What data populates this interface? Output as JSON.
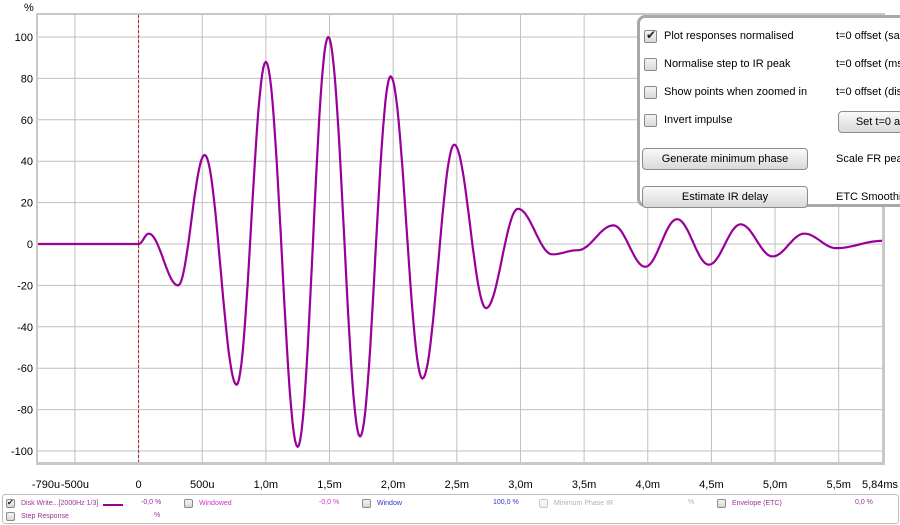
{
  "chart_data": {
    "type": "line",
    "title": "",
    "xlabel": "",
    "ylabel": "%",
    "x_unit_label": "ms",
    "xlim_ms": [
      -0.79,
      5.84
    ],
    "ylim": [
      -110,
      110
    ],
    "y_ticks": [
      100,
      80,
      60,
      40,
      20,
      0,
      -20,
      -40,
      -60,
      -80,
      -100
    ],
    "y_tick_labels": [
      "100",
      "80",
      "60",
      "40",
      "20",
      "0",
      "-20",
      "-40",
      "-60",
      "-80",
      "-100"
    ],
    "x_ticks_ms": [
      -0.79,
      -0.5,
      0,
      0.5,
      1.0,
      1.5,
      2.0,
      2.5,
      3.0,
      3.5,
      4.0,
      4.5,
      5.0,
      5.5,
      5.84
    ],
    "x_tick_labels": [
      "-790u",
      "-500u",
      "0",
      "500u",
      "1,0m",
      "1,5m",
      "2,0m",
      "2,5m",
      "3,0m",
      "3,5m",
      "4,0m",
      "4,5m",
      "5,0m",
      "5,5m",
      "5,84ms"
    ],
    "grid": true,
    "marker_line_ms": 0,
    "series": [
      {
        "name": "Disk Write...[2000Hz 1/3]",
        "color": "#990099",
        "points": [
          [
            -0.79,
            0
          ],
          [
            0,
            0
          ],
          [
            0.08,
            5
          ],
          [
            0.31,
            -20
          ],
          [
            0.52,
            43
          ],
          [
            0.77,
            -68
          ],
          [
            1.0,
            88
          ],
          [
            1.25,
            -98
          ],
          [
            1.49,
            100
          ],
          [
            1.74,
            -93
          ],
          [
            1.98,
            81
          ],
          [
            2.23,
            -65
          ],
          [
            2.48,
            48
          ],
          [
            2.73,
            -31
          ],
          [
            2.98,
            17
          ],
          [
            3.25,
            -5
          ],
          [
            3.45,
            -3
          ],
          [
            3.73,
            9
          ],
          [
            3.98,
            -11
          ],
          [
            4.23,
            12
          ],
          [
            4.48,
            -10
          ],
          [
            4.73,
            9.5
          ],
          [
            4.98,
            -6
          ],
          [
            5.23,
            5
          ],
          [
            5.48,
            -2
          ],
          [
            5.84,
            1.5
          ]
        ]
      }
    ]
  },
  "panel": {
    "checkboxes": [
      {
        "label": "Plot responses normalised",
        "checked": true
      },
      {
        "label": "Normalise step to IR peak",
        "checked": false
      },
      {
        "label": "Show points when zoomed in",
        "checked": false
      },
      {
        "label": "Invert impulse",
        "checked": false
      }
    ],
    "right_labels": [
      "t=0 offset (sa",
      "t=0 offset (ms",
      "t=0 offset (dis"
    ],
    "set_t0_button": "Set t=0 a",
    "generate_min_phase_button": "Generate minimum phase",
    "estimate_ir_delay_button": "Estimate IR delay",
    "scale_fr_label": "Scale FR pea",
    "etc_smoothing_label": "ETC Smoothin"
  },
  "legend": {
    "items": [
      {
        "label": "Disk Write...[2000Hz 1/3]",
        "checked": true,
        "value": "-0,0 %",
        "color": "#993399",
        "has_line": true
      },
      {
        "label": "Windowed",
        "checked": false,
        "value": "-0,0 %",
        "color": "#cc33cc"
      },
      {
        "label": "Window",
        "checked": false,
        "value": "100,0 %",
        "color": "#3333cc"
      },
      {
        "label": "Minimum Phase IR",
        "checked": false,
        "value": "%",
        "color": "#b0b0b0",
        "disabled": true
      },
      {
        "label": "Envelope (ETC)",
        "checked": false,
        "value": "0,0 %",
        "color": "#993399"
      },
      {
        "label": "Step Response",
        "checked": false,
        "value": "%",
        "color": "#993399"
      }
    ]
  }
}
